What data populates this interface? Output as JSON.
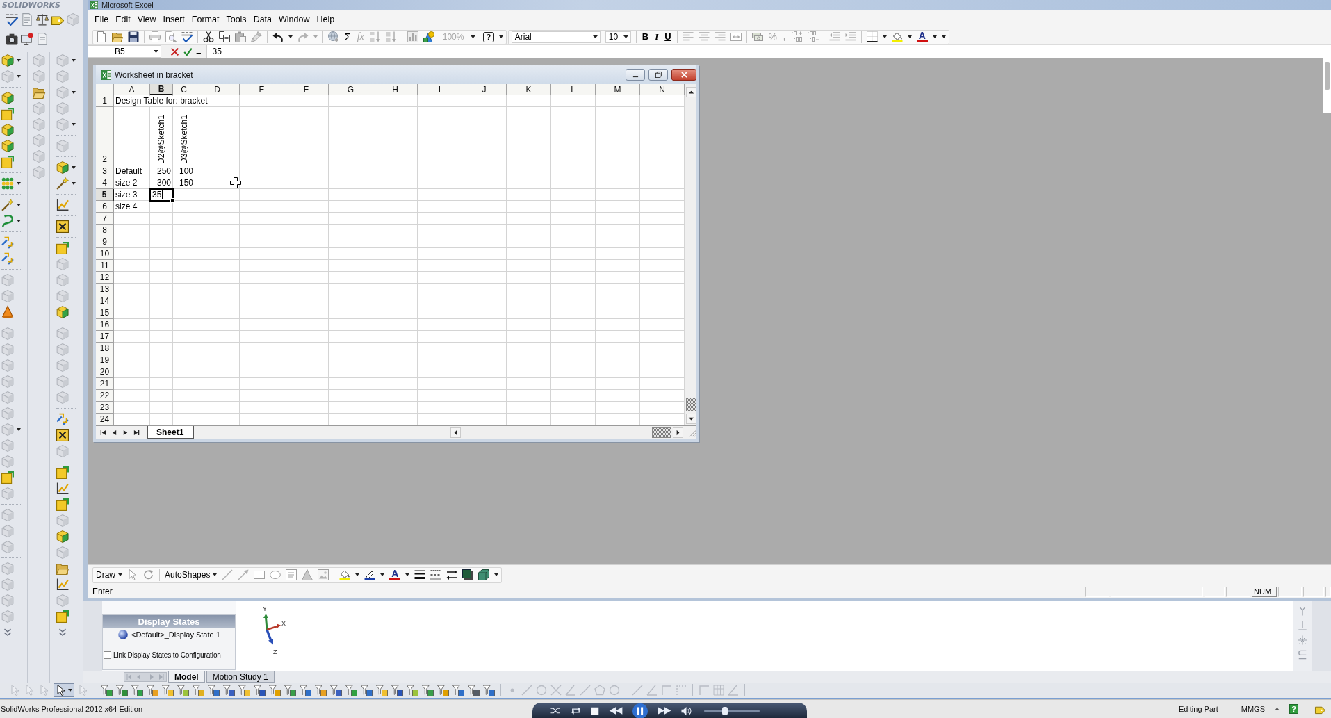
{
  "solidworks_logo": "SOLIDWORKS",
  "excel": {
    "title": "Microsoft Excel",
    "menu": [
      "File",
      "Edit",
      "View",
      "Insert",
      "Format",
      "Tools",
      "Data",
      "Window",
      "Help"
    ],
    "standard_toolbar": {
      "autosum": {
        "label": "Σ",
        "disabled": false
      },
      "insert_function": {
        "label": "fx",
        "disabled": true
      },
      "zoom": {
        "value": "100%",
        "disabled": true
      },
      "help": {
        "label": "?",
        "disabled": false
      }
    },
    "formatting_toolbar": {
      "font": "Arial",
      "font_size": "10",
      "styles": [
        {
          "label": "B",
          "kind": "bold"
        },
        {
          "label": "I",
          "kind": "italic"
        },
        {
          "label": "U",
          "kind": "underline"
        }
      ],
      "percent": {
        "label": "%",
        "disabled": true
      },
      "comma": {
        "label": ",",
        "disabled": true
      },
      "font_color": "A"
    },
    "formula_bar": {
      "name_box": "B5",
      "equals": "=",
      "value": "35"
    },
    "worksheet": {
      "title": "Worksheet in bracket",
      "columns": [
        {
          "label": "A",
          "selected": false
        },
        {
          "label": "B",
          "selected": true
        },
        {
          "label": "C",
          "selected": false
        },
        {
          "label": "D",
          "selected": false
        },
        {
          "label": "E",
          "selected": false
        },
        {
          "label": "F",
          "selected": false
        },
        {
          "label": "G",
          "selected": false
        },
        {
          "label": "H",
          "selected": false
        },
        {
          "label": "I",
          "selected": false
        },
        {
          "label": "J",
          "selected": false
        },
        {
          "label": "K",
          "selected": false
        },
        {
          "label": "L",
          "selected": false
        },
        {
          "label": "M",
          "selected": false
        },
        {
          "label": "N",
          "selected": false
        }
      ],
      "rows": [
        {
          "label": "1",
          "selected": false,
          "cells": {
            "A": {
              "text": "Design Table for: bracket",
              "kind": "text",
              "selected": false
            }
          }
        },
        {
          "label": "2",
          "selected": false,
          "cells": {
            "B": {
              "text": "D2@Sketch1",
              "kind": "vertical",
              "selected": false
            },
            "C": {
              "text": "D3@Sketch1",
              "kind": "vertical",
              "selected": false
            }
          }
        },
        {
          "label": "3",
          "selected": false,
          "cells": {
            "A": {
              "text": "Default",
              "kind": "text",
              "selected": false
            },
            "B": {
              "text": "250",
              "kind": "number",
              "selected": false
            },
            "C": {
              "text": "100",
              "kind": "number",
              "selected": false
            }
          }
        },
        {
          "label": "4",
          "selected": false,
          "cells": {
            "A": {
              "text": "size 2",
              "kind": "text",
              "selected": false
            },
            "B": {
              "text": "300",
              "kind": "number",
              "selected": false
            },
            "C": {
              "text": "150",
              "kind": "number",
              "selected": false
            }
          }
        },
        {
          "label": "5",
          "selected": true,
          "cells": {
            "A": {
              "text": "size 3",
              "kind": "text",
              "selected": false
            },
            "B": {
              "text": "35",
              "kind": "editing",
              "selected": true
            }
          }
        },
        {
          "label": "6",
          "selected": false,
          "cells": {
            "A": {
              "text": "size 4",
              "kind": "text",
              "selected": false
            }
          }
        },
        {
          "label": "7",
          "selected": false
        },
        {
          "label": "8",
          "selected": false
        },
        {
          "label": "9",
          "selected": false
        },
        {
          "label": "10",
          "selected": false
        },
        {
          "label": "11",
          "selected": false
        },
        {
          "label": "12",
          "selected": false
        },
        {
          "label": "13",
          "selected": false
        },
        {
          "label": "14",
          "selected": false
        },
        {
          "label": "15",
          "selected": false
        },
        {
          "label": "16",
          "selected": false
        },
        {
          "label": "17",
          "selected": false
        },
        {
          "label": "18",
          "selected": false
        },
        {
          "label": "19",
          "selected": false
        },
        {
          "label": "20",
          "selected": false
        },
        {
          "label": "21",
          "selected": false
        },
        {
          "label": "22",
          "selected": false
        },
        {
          "label": "23",
          "selected": false
        },
        {
          "label": "24",
          "selected": false
        }
      ],
      "sheet_tabs": [
        {
          "label": "Sheet1",
          "selected": true
        }
      ]
    },
    "drawing_toolbar": {
      "draw": "Draw",
      "autoshapes": "AutoShapes",
      "font_color": "A"
    },
    "status_bar": {
      "mode": "Enter",
      "indicator": "NUM"
    }
  },
  "solidworks": {
    "display_states": {
      "title": "Display States",
      "items": [
        {
          "label": "<Default>_Display State 1",
          "selected": false
        }
      ],
      "link_option": {
        "label": "Link Display States to Configuration",
        "checked": false
      }
    },
    "triad_axes": [
      "Y",
      "X",
      "Z"
    ],
    "tabs": [
      {
        "label": "Model",
        "selected": true
      },
      {
        "label": "Motion Study 1",
        "selected": false
      }
    ],
    "toolbar": {
      "select_tool": {
        "on": true
      }
    },
    "status_bar": {
      "edition": "SolidWorks Professional 2012 x64 Edition",
      "mode": "Editing Part",
      "units": "MMGS",
      "help": "?"
    }
  },
  "media_player": {
    "volume": {
      "level": 0.37
    }
  }
}
